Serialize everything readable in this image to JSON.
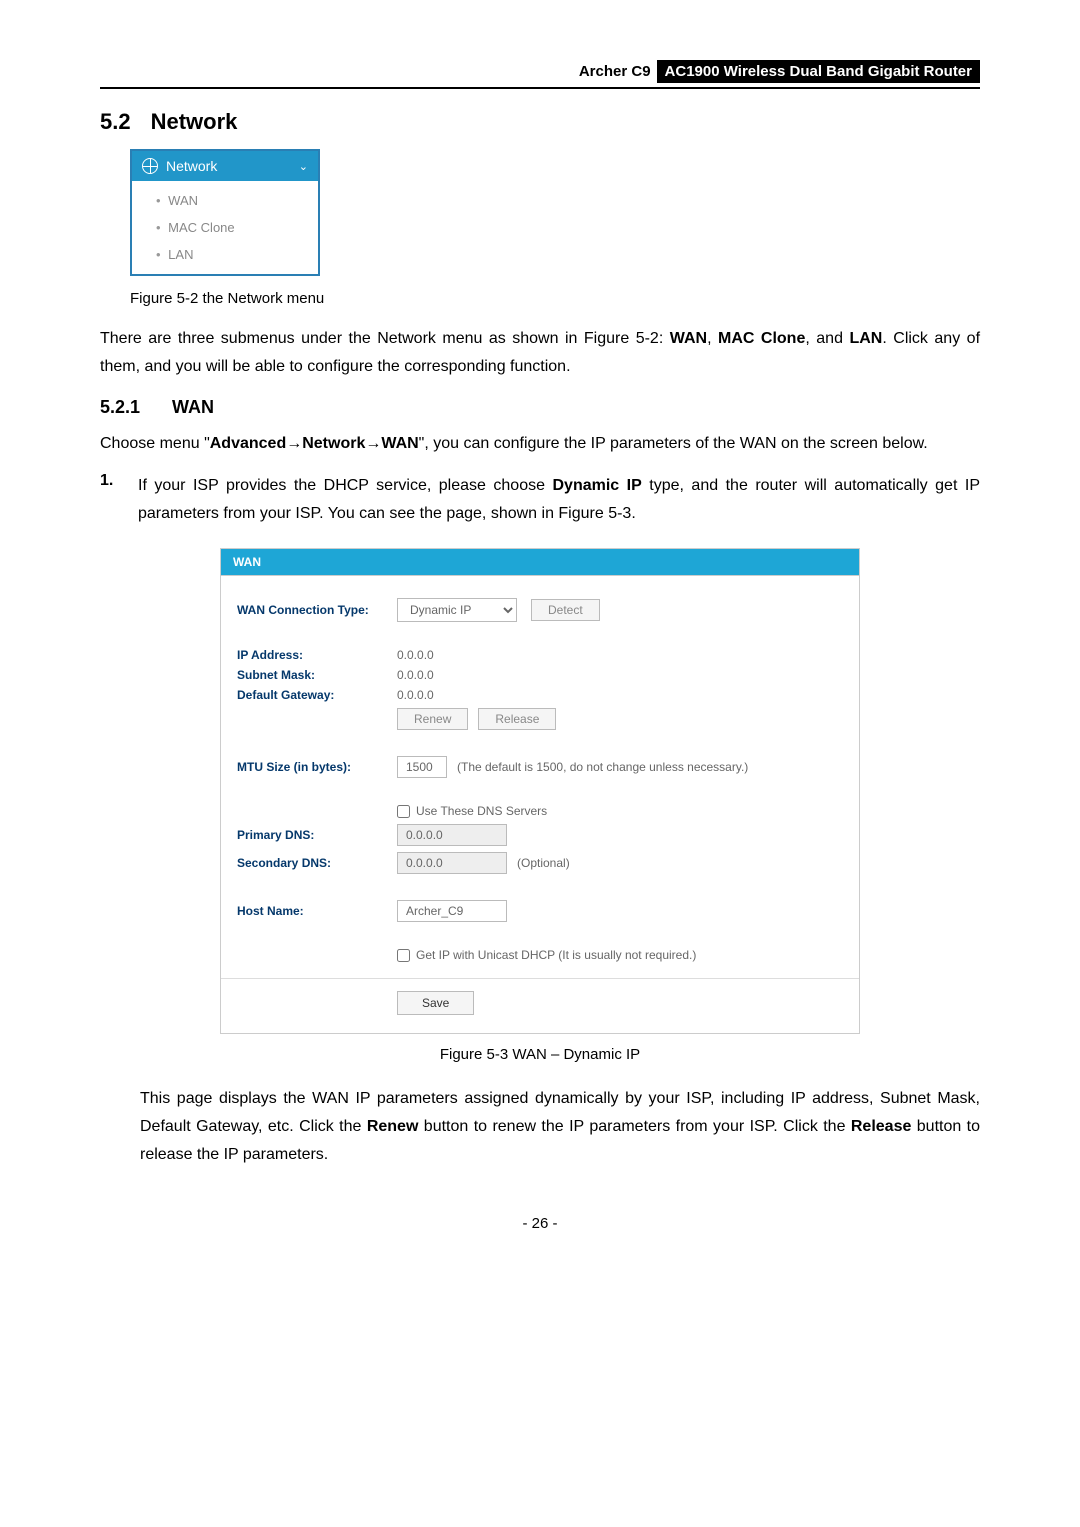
{
  "header": {
    "model": "Archer C9",
    "title": "AC1900 Wireless Dual Band Gigabit Router"
  },
  "section": {
    "number": "5.2",
    "title": "Network"
  },
  "menu_figure": {
    "header": "Network",
    "items": [
      "WAN",
      "MAC Clone",
      "LAN"
    ],
    "caption": "Figure 5-2 the Network menu"
  },
  "intro_para": {
    "t1": "There are three submenus under the Network menu as shown in Figure 5-2: ",
    "b1": "WAN",
    "c1": ", ",
    "b2": "MAC Clone",
    "t2": ", and ",
    "b3": "LAN",
    "t3": ". Click any of them, and you will be able to configure the corresponding function."
  },
  "subsection": {
    "number": "5.2.1",
    "title": "WAN"
  },
  "choose_para": {
    "t1": "Choose menu \"",
    "b1": "Advanced",
    "arrow1": "→",
    "b2": "Network",
    "arrow2": "→",
    "b3": "WAN",
    "t2": "\", you can configure the IP parameters of the WAN on the screen below."
  },
  "list1": {
    "idx": "1.",
    "t1": "If your ISP provides the DHCP service, please choose ",
    "b1": "Dynamic IP",
    "t2": " type, and the router will automatically get IP parameters from your ISP. You can see the page, shown in Figure 5-3."
  },
  "wan_panel": {
    "heading": "WAN",
    "conn_type_label": "WAN Connection Type:",
    "conn_type_value": "Dynamic IP",
    "detect_btn": "Detect",
    "ip_label": "IP Address:",
    "ip_value": "0.0.0.0",
    "subnet_label": "Subnet Mask:",
    "subnet_value": "0.0.0.0",
    "gw_label": "Default Gateway:",
    "gw_value": "0.0.0.0",
    "renew_btn": "Renew",
    "release_btn": "Release",
    "mtu_label": "MTU Size (in bytes):",
    "mtu_value": "1500",
    "mtu_note": "(The default is 1500, do not change unless necessary.)",
    "use_dns_label": "Use These DNS Servers",
    "pdns_label": "Primary DNS:",
    "pdns_value": "0.0.0.0",
    "sdns_label": "Secondary DNS:",
    "sdns_value": "0.0.0.0",
    "optional": "(Optional)",
    "host_label": "Host Name:",
    "host_value": "Archer_C9",
    "unicast_label": "Get IP with Unicast DHCP (It is usually not required.)",
    "save_btn": "Save"
  },
  "figure3_caption": "Figure 5-3 WAN – Dynamic IP",
  "desc_para": {
    "t1": "This page displays the WAN IP parameters assigned dynamically by your ISP, including IP address, Subnet Mask, Default Gateway, etc. Click the ",
    "b1": "Renew",
    "t2": " button to renew the IP parameters from your ISP. Click the ",
    "b2": "Release",
    "t3": " button to release the IP parameters."
  },
  "page_number": "- 26 -"
}
